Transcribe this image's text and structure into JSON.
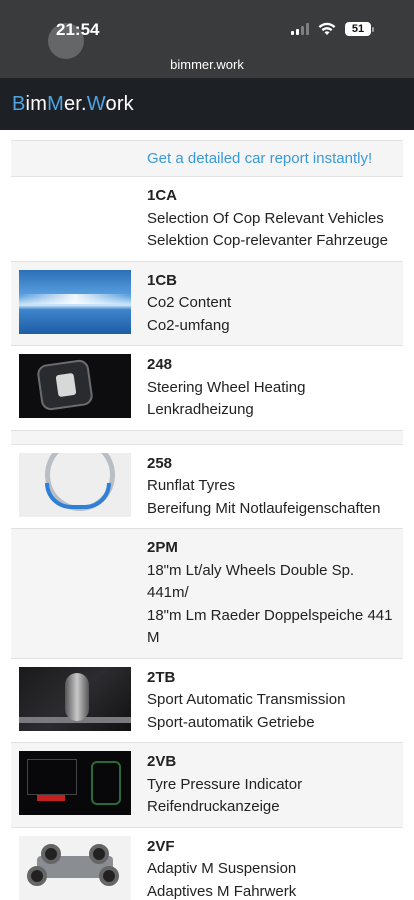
{
  "status_bar": {
    "time": "21:54",
    "battery": "51",
    "url": "bimmer.work"
  },
  "brand": {
    "part1_accent": "B",
    "part2": "im",
    "part3_accent": "M",
    "part4": "er.",
    "part5_accent": "W",
    "part6": "ork",
    "accent_color": "#4fa3e0"
  },
  "promo": {
    "text": "Get a detailed car report instantly!"
  },
  "options": [
    {
      "code": "1CA",
      "name_en": "Selection Of Cop Relevant Vehicles",
      "name_de": "Selektion Cop-relevanter Fahrzeuge",
      "image": "none"
    },
    {
      "code": "1CB",
      "name_en": "Co2 Content",
      "name_de": "Co2-umfang",
      "image": "sky-horizon"
    },
    {
      "code": "248",
      "name_en": "Steering Wheel Heating",
      "name_de": "Lenkradheizung",
      "image": "heating-button"
    },
    {
      "code": "258",
      "name_en": "Runflat Tyres",
      "name_de": "Bereifung Mit Notlaufeigenschaften",
      "image": "tyre-section"
    },
    {
      "code": "2PM",
      "name_en": "18\"m Lt/aly Wheels Double Sp. 441m/",
      "name_de": "18\"m Lm Raeder Doppelspeiche 441 M",
      "image": "none"
    },
    {
      "code": "2TB",
      "name_en": "Sport Automatic Transmission",
      "name_de": "Sport-automatik Getriebe",
      "image": "gear-lever"
    },
    {
      "code": "2VB",
      "name_en": "Tyre Pressure Indicator",
      "name_de": "Reifendruckanzeige",
      "image": "tpms-screen"
    },
    {
      "code": "2VF",
      "name_en": "Adaptiv M Suspension",
      "name_de": "Adaptives M Fahrwerk",
      "image": "chassis"
    }
  ]
}
